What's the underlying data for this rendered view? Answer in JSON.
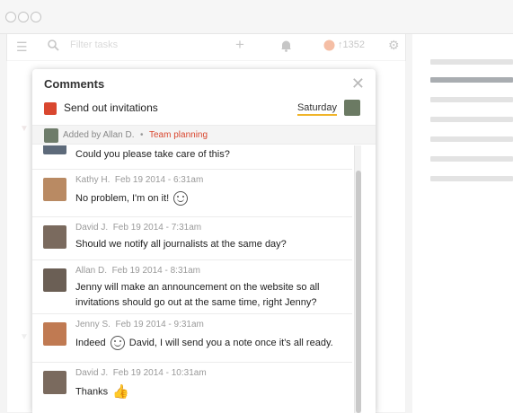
{
  "toolbar": {
    "filter_placeholder": "Filter tasks",
    "karma": "1352"
  },
  "modal": {
    "title": "Comments",
    "task_name": "Send out invitations",
    "due_date": "Saturday",
    "added_by": "Added by Allan D.",
    "separator": "•",
    "project": "Team planning"
  },
  "comments": [
    {
      "author": "",
      "time": "",
      "text": "Could you please take care of this?"
    },
    {
      "author": "Kathy H.",
      "time": "Feb 19 2014 - 6:31am",
      "text": "No problem, I'm on it!"
    },
    {
      "author": "David J.",
      "time": "Feb 19 2014 - 7:31am",
      "text": "Should we notify all journalists at the same day?"
    },
    {
      "author": "Allan D.",
      "time": "Feb 19 2014 - 8:31am",
      "text": "Jenny will make an announcement on the website so all invitations should go out at the same time, right Jenny?"
    },
    {
      "author": "Jenny S.",
      "time": "Feb 19 2014 - 9:31am",
      "text_before": "Indeed",
      "text_after": "David, I will send you a note once it's all ready."
    },
    {
      "author": "David J.",
      "time": "Feb 19 2014 - 10:31am",
      "text": "Thanks"
    }
  ],
  "colors": {
    "priority": "#d9472f",
    "project_link": "#d9472f",
    "date_underline": "#f0b429"
  },
  "icons": [
    "menu-icon",
    "search-icon",
    "plus-icon",
    "bell-icon",
    "karma-icon",
    "gear-icon",
    "close-icon",
    "smiley-icon",
    "thumbs-up-icon"
  ]
}
